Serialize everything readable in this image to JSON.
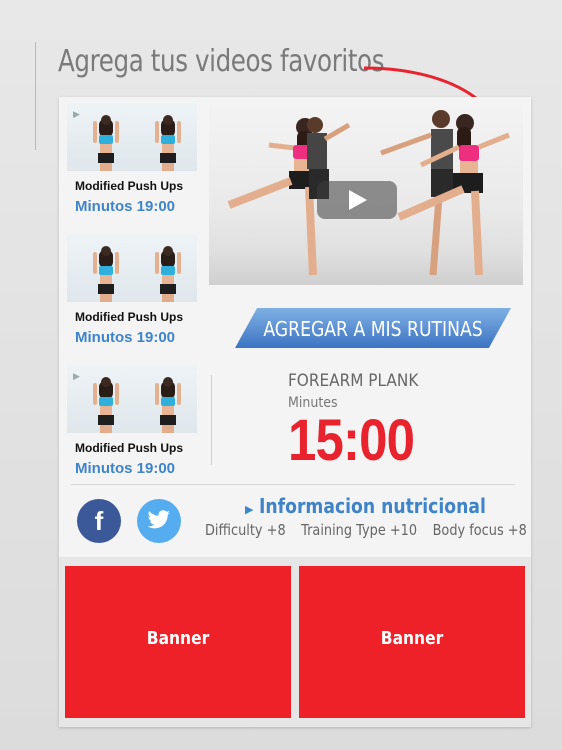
{
  "heading": "Agrega tus videos favoritos",
  "thumbnails": [
    {
      "title": "Modified Push Ups",
      "time": "Minutos 19:00"
    },
    {
      "title": "Modified Push Ups",
      "time": "Minutos 19:00"
    },
    {
      "title": "Modified Push Ups",
      "time": "Minutos 19:00"
    }
  ],
  "video": {
    "play_icon": "play-icon"
  },
  "add_button": "AGREGAR A MIS RUTINAS",
  "exercise": {
    "name": "FOREARM PLANK",
    "unit": "Minutes",
    "time": "15:00"
  },
  "social": {
    "facebook": "f",
    "twitter_icon": "twitter-bird-icon"
  },
  "nutrition": {
    "label": "Informacion nutricional"
  },
  "stats": [
    {
      "text": "Difficulty  +8"
    },
    {
      "text": "Training Type  +10"
    },
    {
      "text": "Body focus  +8"
    }
  ],
  "banners": [
    "Banner",
    "Banner"
  ],
  "colors": {
    "accent_red": "#e8232d",
    "accent_blue": "#3f84c8",
    "facebook": "#3b5998",
    "twitter": "#55acee"
  }
}
